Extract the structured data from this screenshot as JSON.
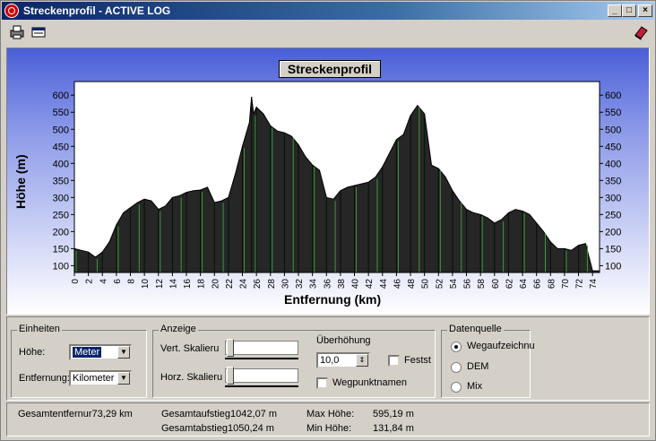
{
  "window": {
    "title": "Streckenprofil - ACTIVE LOG",
    "minimize": "_",
    "maximize": "□",
    "close": "×"
  },
  "chart_data": {
    "type": "area",
    "title": "Streckenprofil",
    "xlabel": "Entfernung (km)",
    "ylabel": "Höhe (m)",
    "xlim": [
      0,
      75
    ],
    "ylim": [
      80,
      640
    ],
    "x_ticks": [
      0,
      2,
      4,
      6,
      8,
      10,
      12,
      14,
      16,
      18,
      20,
      22,
      24,
      26,
      28,
      30,
      32,
      34,
      36,
      38,
      40,
      42,
      44,
      46,
      48,
      50,
      52,
      54,
      56,
      58,
      60,
      62,
      64,
      66,
      68,
      70,
      72,
      74
    ],
    "y_ticks": [
      100,
      150,
      200,
      250,
      300,
      350,
      400,
      450,
      500,
      550,
      600
    ],
    "grid": false,
    "series": [
      {
        "x": [
          0,
          1,
          2,
          3,
          4,
          5,
          6,
          7,
          8,
          9,
          10,
          11,
          12,
          13,
          14,
          15,
          16,
          17,
          18,
          19,
          20,
          21,
          22,
          23,
          24,
          25,
          25.3,
          25.6,
          26,
          27,
          28,
          29,
          30,
          31,
          32,
          33,
          34,
          35,
          36,
          37,
          38,
          39,
          40,
          41,
          42,
          43,
          44,
          45,
          46,
          47,
          48,
          49,
          50,
          51,
          52,
          53,
          54,
          55,
          56,
          57,
          58,
          59,
          60,
          61,
          62,
          63,
          64,
          65,
          66,
          67,
          68,
          69,
          70,
          71,
          72,
          73,
          74,
          75
        ],
        "y": [
          150,
          145,
          140,
          125,
          140,
          170,
          220,
          255,
          270,
          285,
          295,
          290,
          265,
          275,
          300,
          305,
          315,
          320,
          322,
          330,
          285,
          290,
          300,
          370,
          450,
          520,
          595,
          545,
          565,
          545,
          510,
          495,
          490,
          480,
          455,
          420,
          395,
          380,
          300,
          295,
          320,
          330,
          335,
          340,
          345,
          360,
          390,
          430,
          470,
          485,
          540,
          570,
          545,
          395,
          385,
          360,
          320,
          290,
          265,
          255,
          250,
          240,
          225,
          235,
          255,
          265,
          260,
          250,
          225,
          200,
          170,
          150,
          150,
          145,
          160,
          165,
          85,
          85
        ]
      }
    ]
  },
  "controls": {
    "einheiten": {
      "legend": "Einheiten",
      "hoehe_label": "Höhe:",
      "hoehe_value": "Meter",
      "entfernung_label": "Entfernung:",
      "entfernung_value": "Kilometer"
    },
    "anzeige": {
      "legend": "Anzeige",
      "vert_label": "Vert. Skalieru",
      "horz_label": "Horz. Skalieru",
      "ueberhoehung_label": "Überhöhung",
      "ueberhoehung_value": "10,0",
      "fest_label": "Festst",
      "wegpunkt_label": "Wegpunktnamen"
    },
    "datenquelle": {
      "legend": "Datenquelle",
      "opt1": "Wegaufzeichnu",
      "opt2": "DEM",
      "opt3": "Mix"
    }
  },
  "status": {
    "gesamtentfernung": "Gesamtentfernur73,29 km",
    "aufstieg": "Gesamtaufstieg1042,07 m",
    "abstieg": "Gesamtabstieg1050,24 m",
    "max_label": "Max Höhe:",
    "max_value": "595,19 m",
    "min_label": "Min Höhe:",
    "min_value": "131,84 m"
  }
}
